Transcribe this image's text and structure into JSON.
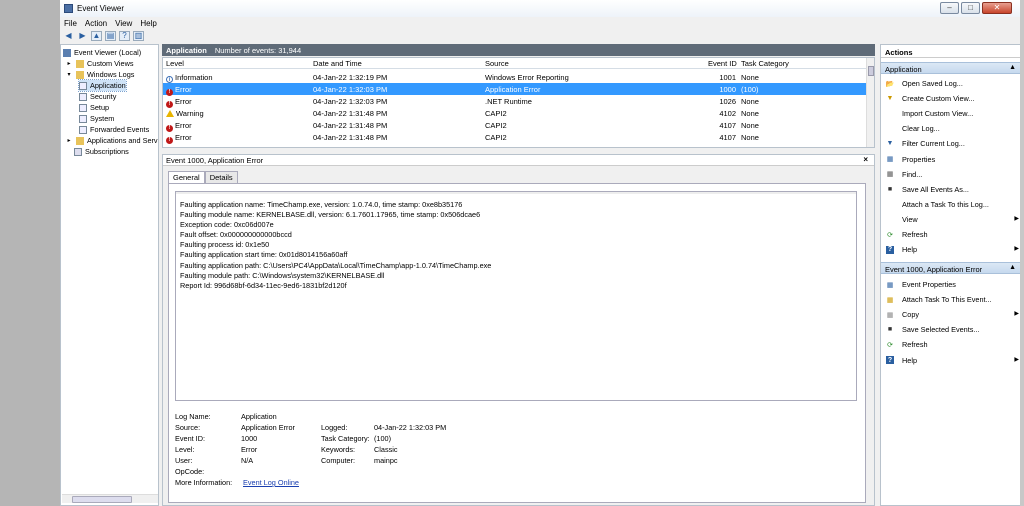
{
  "window": {
    "title": "Event Viewer"
  },
  "menu": [
    "File",
    "Action",
    "View",
    "Help"
  ],
  "tree": {
    "root": "Event Viewer (Local)",
    "custom_views": "Custom Views",
    "windows_logs": "Windows Logs",
    "logs": [
      "Application",
      "Security",
      "Setup",
      "System",
      "Forwarded Events"
    ],
    "apps_services": "Applications and Servic",
    "subscriptions": "Subscriptions"
  },
  "center": {
    "log_name": "Application",
    "event_count": "Number of events: 31,944",
    "columns": {
      "level": "Level",
      "date": "Date and Time",
      "source": "Source",
      "event_id": "Event ID",
      "task": "Task Category"
    },
    "rows": [
      {
        "level": "Information",
        "date": "04-Jan-22 1:32:19 PM",
        "source": "Windows Error Reporting",
        "event_id": "1001",
        "task": "None"
      },
      {
        "level": "Error",
        "date": "04-Jan-22 1:32:03 PM",
        "source": "Application Error",
        "event_id": "1000",
        "task": "(100)"
      },
      {
        "level": "Error",
        "date": "04-Jan-22 1:32:03 PM",
        "source": ".NET Runtime",
        "event_id": "1026",
        "task": "None"
      },
      {
        "level": "Warning",
        "date": "04-Jan-22 1:31:48 PM",
        "source": "CAPI2",
        "event_id": "4102",
        "task": "None"
      },
      {
        "level": "Error",
        "date": "04-Jan-22 1:31:48 PM",
        "source": "CAPI2",
        "event_id": "4107",
        "task": "None"
      },
      {
        "level": "Error",
        "date": "04-Jan-22 1:31:48 PM",
        "source": "CAPI2",
        "event_id": "4107",
        "task": "None"
      }
    ]
  },
  "detail": {
    "title": "Event 1000, Application Error",
    "close": "×",
    "tabs": [
      "General",
      "Details"
    ],
    "description": [
      "Faulting application name: TimeChamp.exe, version: 1.0.74.0, time stamp: 0xe8b35176",
      "Faulting module name: KERNELBASE.dll, version: 6.1.7601.17965, time stamp: 0x506dcae6",
      "Exception code: 0xc06d007e",
      "Fault offset: 0x000000000000bccd",
      "Faulting process id: 0x1e50",
      "Faulting application start time: 0x01d8014156a60aff",
      "Faulting application path: C:\\Users\\PC4\\AppData\\Local\\TimeChamp\\app-1.0.74\\TimeChamp.exe",
      "Faulting module path: C:\\Windows\\system32\\KERNELBASE.dll",
      "Report Id: 996d68bf-6d34-11ec-9ed6-1831bf2d120f"
    ],
    "props": {
      "log_name_label": "Log Name:",
      "log_name": "Application",
      "source_label": "Source:",
      "source": "Application Error",
      "logged_label": "Logged:",
      "logged": "04-Jan-22 1:32:03 PM",
      "event_id_label": "Event ID:",
      "event_id": "1000",
      "task_label": "Task Category:",
      "task": "(100)",
      "level_label": "Level:",
      "level": "Error",
      "keywords_label": "Keywords:",
      "keywords": "Classic",
      "user_label": "User:",
      "user": "N/A",
      "computer_label": "Computer:",
      "computer": "mainpc",
      "opcode_label": "OpCode:",
      "more_info_label": "More Information:",
      "more_info_link": "Event Log Online"
    }
  },
  "actions": {
    "title": "Actions",
    "section1": "Application",
    "items1": [
      "Open Saved Log...",
      "Create Custom View...",
      "Import Custom View...",
      "Clear Log...",
      "Filter Current Log...",
      "Properties",
      "Find...",
      "Save All Events As...",
      "Attach a Task To this Log...",
      "View",
      "Refresh",
      "Help"
    ],
    "section2": "Event 1000, Application Error",
    "items2": [
      "Event Properties",
      "Attach Task To This Event...",
      "Copy",
      "Save Selected Events...",
      "Refresh",
      "Help"
    ]
  },
  "colors": {
    "selection": "#3399ff",
    "header": "#5f6b78",
    "error": "#c01818",
    "warning": "#e8b400"
  }
}
